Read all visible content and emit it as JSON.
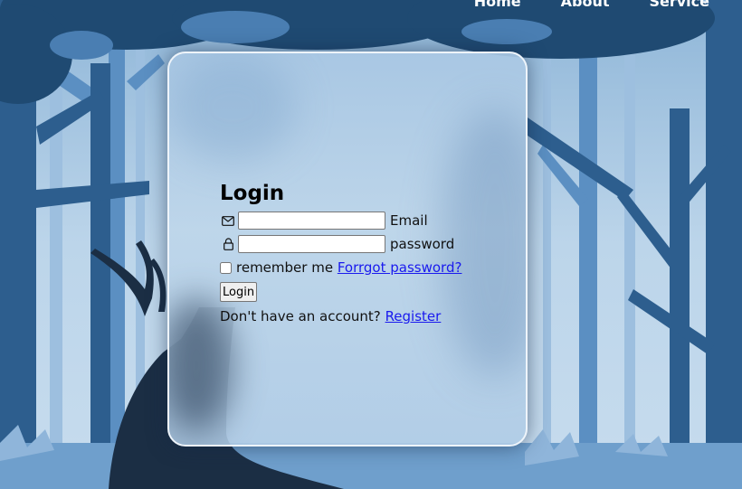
{
  "nav": {
    "items": [
      "Home",
      "About",
      "Service"
    ]
  },
  "login": {
    "title": "Login",
    "email_label": "Email",
    "email_value": "",
    "password_label": "password",
    "password_value": "",
    "remember_label": "remember me",
    "forgot_link": "Forrgot password?",
    "login_button": "Login",
    "register_prompt": "Don't have an account?",
    "register_link": "Register"
  },
  "icons": {
    "email": "mail-icon",
    "password": "lock-icon"
  },
  "colors": {
    "sky": "#b9d3ea",
    "tree_dark": "#1f4a72",
    "tree_mid": "#3f76aa",
    "tree_light": "#6fa0cc",
    "deer": "#1b2e44",
    "link": "#1a1aee"
  }
}
